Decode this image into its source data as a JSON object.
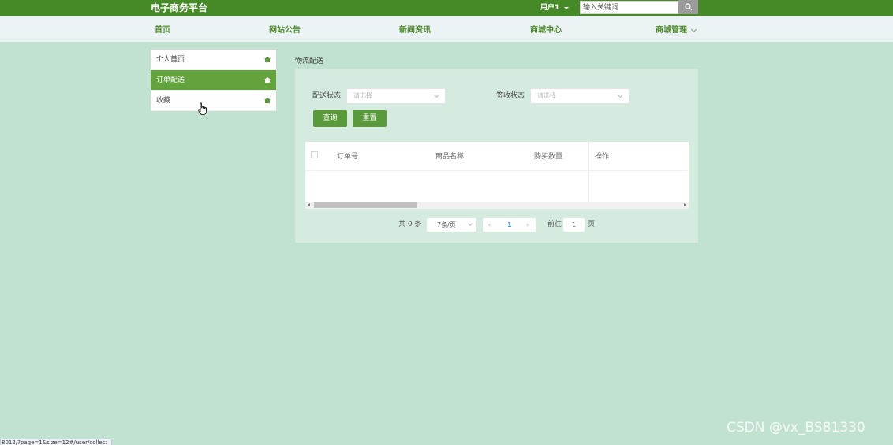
{
  "header": {
    "site_title": "电子商务平台",
    "user_label": "用户1",
    "search_placeholder": "输入关键词"
  },
  "nav": {
    "items": [
      "首页",
      "网站公告",
      "新闻资讯",
      "商城中心",
      "商城管理"
    ]
  },
  "sidebar": {
    "items": [
      {
        "label": "个人首页",
        "active": false
      },
      {
        "label": "订单配送",
        "active": true
      },
      {
        "label": "收藏",
        "active": false
      }
    ]
  },
  "main": {
    "breadcrumb": "物流配送",
    "filters": {
      "delivery_status_label": "配送状态",
      "delivery_status_placeholder": "请选择",
      "receive_status_label": "签收状态",
      "receive_status_placeholder": "请选择"
    },
    "buttons": {
      "query": "查询",
      "reset": "重置"
    },
    "table": {
      "columns": [
        "订单号",
        "商品名称",
        "购买数量",
        "操作"
      ],
      "rows": []
    },
    "pagination": {
      "total_text": "共 0 条",
      "page_size": "7条/页",
      "current_page": "1",
      "goto_label": "前往",
      "goto_value": "1",
      "page_suffix": "页"
    }
  },
  "footer": {
    "watermark": "CSDN @vx_BS81330",
    "status_url": "8012/?page=1&size=12#/user/collect"
  },
  "colors": {
    "header_green": "#458a27",
    "nav_text_green": "#4e8a2c",
    "active_green": "#62a33e",
    "button_green": "#5b9a3c",
    "page_background": "#c1e2d0",
    "panel_background": "#d6ebe0"
  }
}
